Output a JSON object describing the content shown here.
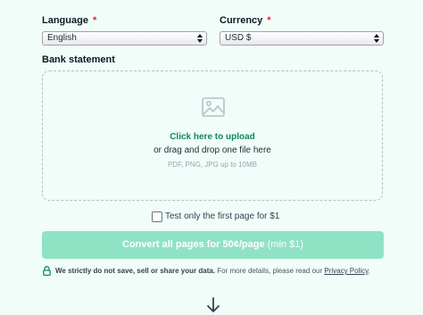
{
  "form": {
    "language": {
      "label": "Language",
      "required_mark": "*",
      "selected": "English"
    },
    "currency": {
      "label": "Currency",
      "required_mark": "*",
      "selected": "USD $"
    },
    "bank_statement": {
      "label": "Bank statement"
    }
  },
  "upload": {
    "icon": "image-icon",
    "click_text": "Click here to upload",
    "drag_text": "or drag and drop one file here",
    "formats_text": "PDF, PNG, JPG up to 10MB"
  },
  "test_option": {
    "label": "Test only the first page for $1",
    "checked": false
  },
  "convert_button": {
    "main": "Convert all pages for 50¢/page",
    "min": "(min $1)"
  },
  "privacy": {
    "icon": "lock-icon",
    "strong": "We strictly do not save, sell or share your data.",
    "text": "For more details, please read our",
    "link": "Privacy Policy",
    "end": "."
  },
  "scroll_hint": {
    "icon": "arrow-down-icon"
  },
  "colors": {
    "brand_green": "#0e8a5f",
    "button_bg": "#90e2c5",
    "required": "#e11d48",
    "background": "#f0fdf8"
  }
}
